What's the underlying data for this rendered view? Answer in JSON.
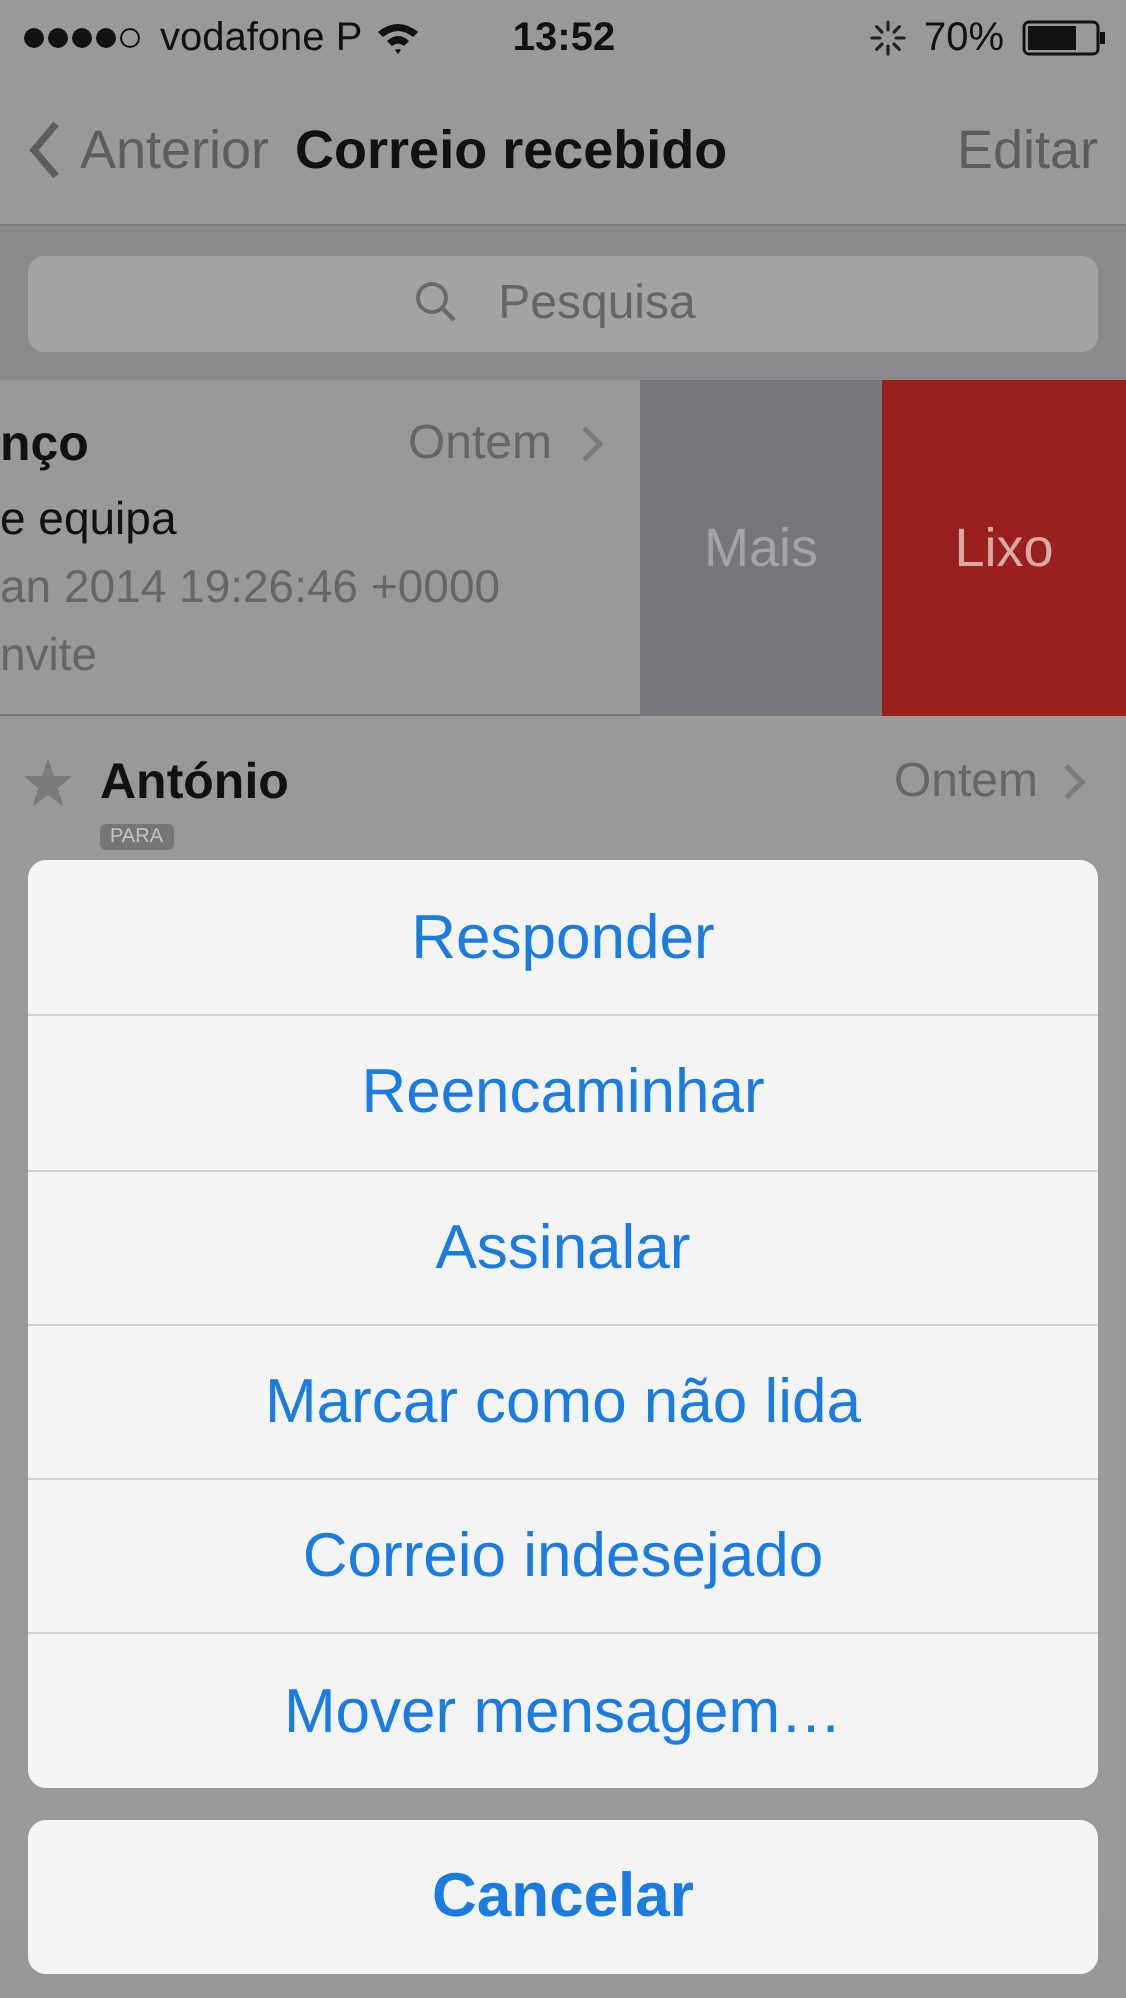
{
  "status_bar": {
    "carrier": "vodafone P",
    "time": "13:52",
    "battery": "70%"
  },
  "nav": {
    "back": "Anterior",
    "title": "Correio recebido",
    "action": "Editar"
  },
  "search": {
    "placeholder": "Pesquisa"
  },
  "swiped_message": {
    "sender": "nço",
    "date": "Ontem",
    "subject": "e equipa",
    "preview": [
      "an 2014 19:26:46 +0000",
      "nvite"
    ],
    "actions": [
      {
        "label": "Mais",
        "kind": "more"
      },
      {
        "label": "Lixo",
        "kind": "trash"
      }
    ]
  },
  "messages": [
    {
      "sender": "António",
      "date": "Ontem",
      "starred": true,
      "tag": "PARA"
    }
  ],
  "action_sheet": {
    "actions": [
      "Responder",
      "Reencaminhar",
      "Assinalar",
      "Marcar como não lida",
      "Correio indesejado",
      "Mover mensagem…"
    ],
    "cancel": "Cancelar"
  }
}
